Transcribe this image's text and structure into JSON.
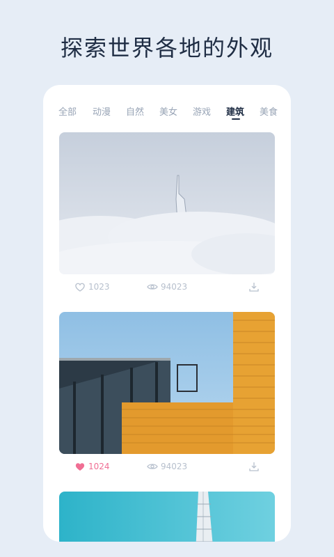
{
  "headline": "探索世界各地的外观",
  "tabs": [
    {
      "label": "全部"
    },
    {
      "label": "动漫"
    },
    {
      "label": "自然"
    },
    {
      "label": "美女"
    },
    {
      "label": "游戏"
    },
    {
      "label": "建筑",
      "active": true
    },
    {
      "label": "美食"
    }
  ],
  "posts": [
    {
      "subject": "tower above clouds",
      "likes": "1023",
      "liked": false,
      "views": "94023"
    },
    {
      "subject": "modern glass and orange building",
      "likes": "1024",
      "liked": true,
      "views": "94023"
    },
    {
      "subject": "sail-shaped tower against sky",
      "likes": "",
      "liked": false,
      "views": ""
    }
  ],
  "colors": {
    "background": "#e6edf6",
    "card": "#ffffff",
    "accent_like": "#f06f94",
    "text_dark": "#1f2d44",
    "text_muted": "#98a4b6"
  }
}
